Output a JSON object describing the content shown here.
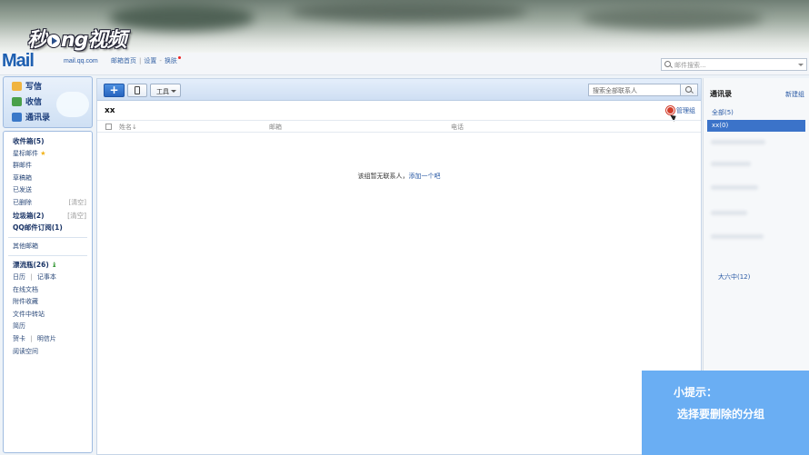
{
  "overlay": {
    "video_logo_before": "秒",
    "video_logo_after": "ng视频",
    "play_glyph": "play-icon"
  },
  "header": {
    "logo_text": "Mail",
    "domain": "mail.qq.com",
    "links": [
      "邮箱首页",
      "设置",
      "换肤"
    ],
    "mail_search_placeholder": "邮件搜索..."
  },
  "sidebar": {
    "top_nav": [
      {
        "label": "写信",
        "icon": "pencil-icon",
        "color": "#e8a020"
      },
      {
        "label": "收信",
        "icon": "inbox-icon",
        "color": "#3a8d3a"
      },
      {
        "label": "通讯录",
        "icon": "contacts-icon",
        "color": "#2a6ac2"
      }
    ],
    "folders": [
      {
        "label": "收件箱(5)",
        "bold": true
      },
      {
        "label": "星标邮件",
        "star": "★"
      },
      {
        "label": "群邮件"
      },
      {
        "label": "草稿箱"
      },
      {
        "label": "已发送"
      },
      {
        "label": "已删除",
        "action": "[清空]"
      },
      {
        "label": "垃圾箱(2)",
        "bold": true,
        "action": "[清空]"
      },
      {
        "label": "QQ邮件订阅(1)",
        "bold": true
      }
    ],
    "other_mailbox": "其他邮箱",
    "apps": [
      {
        "label": "漂流瓶(26)",
        "bold": true,
        "bottle": "♝"
      },
      {
        "label": "日历",
        "label2": "记事本"
      },
      {
        "label": "在线文档"
      },
      {
        "label": "附件收藏"
      },
      {
        "label": "文件中转站"
      },
      {
        "label": "简历"
      },
      {
        "label": "贺卡",
        "label2": "明信片"
      },
      {
        "label": "阅读空间"
      }
    ]
  },
  "main": {
    "toolbar": {
      "add_label": "+",
      "tools_label": "工具",
      "search_placeholder": "搜索全部联系人"
    },
    "group_title": "xx",
    "manage_label": "管理组",
    "columns": [
      "姓名↓",
      "邮箱",
      "电话"
    ],
    "empty_text": "该组暂无联系人，",
    "empty_link": "添加一个吧"
  },
  "right_panel": {
    "title": "通讯录",
    "new_group": "新建组",
    "groups": [
      "全部(5)",
      "xx(0)"
    ],
    "selected_index": 1,
    "extra_group": "大六中(12)"
  },
  "tip": {
    "title": "小提示：",
    "text": "选择要删除的分组"
  }
}
